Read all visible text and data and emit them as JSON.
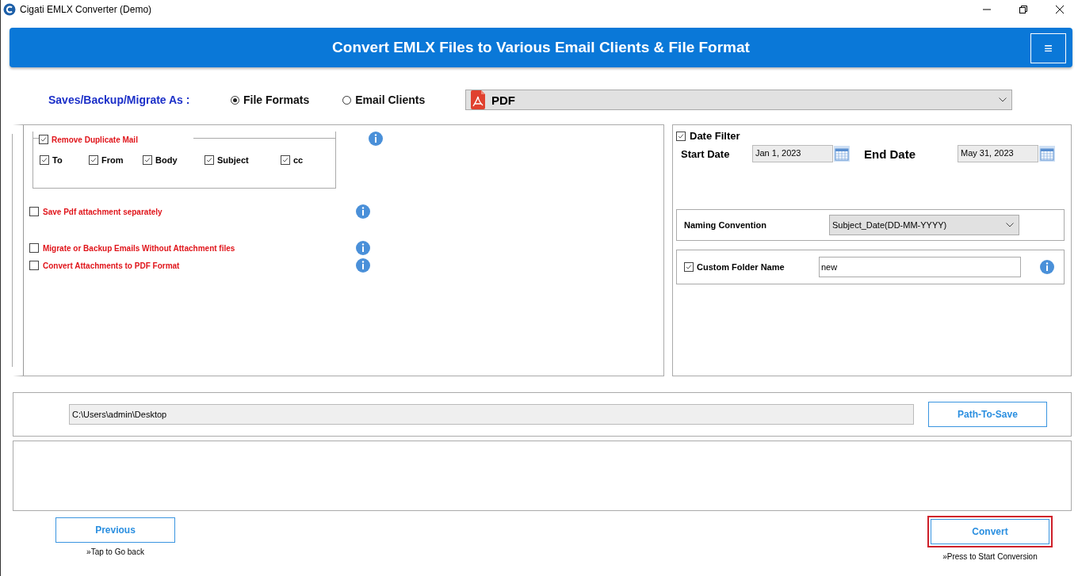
{
  "window": {
    "title": "Cigati EMLX Converter (Demo)"
  },
  "header": {
    "title": "Convert EMLX Files to Various Email Clients & File Format",
    "menu_icon": "≡"
  },
  "save_as": {
    "label": "Saves/Backup/Migrate As :",
    "options": [
      {
        "label": "File Formats",
        "selected": true
      },
      {
        "label": "Email Clients",
        "selected": false
      }
    ],
    "format": "PDF"
  },
  "duplicate": {
    "label": "Remove Duplicate Mail",
    "checked": true,
    "fields": [
      {
        "label": "To",
        "checked": true
      },
      {
        "label": "From",
        "checked": true
      },
      {
        "label": "Body",
        "checked": true
      },
      {
        "label": "Subject",
        "checked": true
      },
      {
        "label": "cc",
        "checked": true
      }
    ]
  },
  "options": [
    {
      "label": "Save Pdf attachment separately",
      "checked": false
    },
    {
      "label": "Migrate or Backup Emails Without Attachment files",
      "checked": false
    },
    {
      "label": "Convert Attachments to PDF Format",
      "checked": false
    }
  ],
  "date_filter": {
    "label": "Date Filter",
    "checked": true,
    "start_label": "Start Date",
    "start": "Jan 1, 2023",
    "end_label": "End Date",
    "end": "May 31, 2023"
  },
  "naming": {
    "label": "Naming Convention",
    "value": "Subject_Date(DD-MM-YYYY)"
  },
  "custom_folder": {
    "label": "Custom Folder Name",
    "checked": true,
    "value": "new"
  },
  "path": {
    "value": "C:\\Users\\admin\\Desktop",
    "button": "Path-To-Save"
  },
  "previous": {
    "label": "Previous",
    "hint": "»Tap to Go back"
  },
  "convert": {
    "label": "Convert",
    "hint": "»Press to Start Conversion",
    "highlighted": true
  }
}
